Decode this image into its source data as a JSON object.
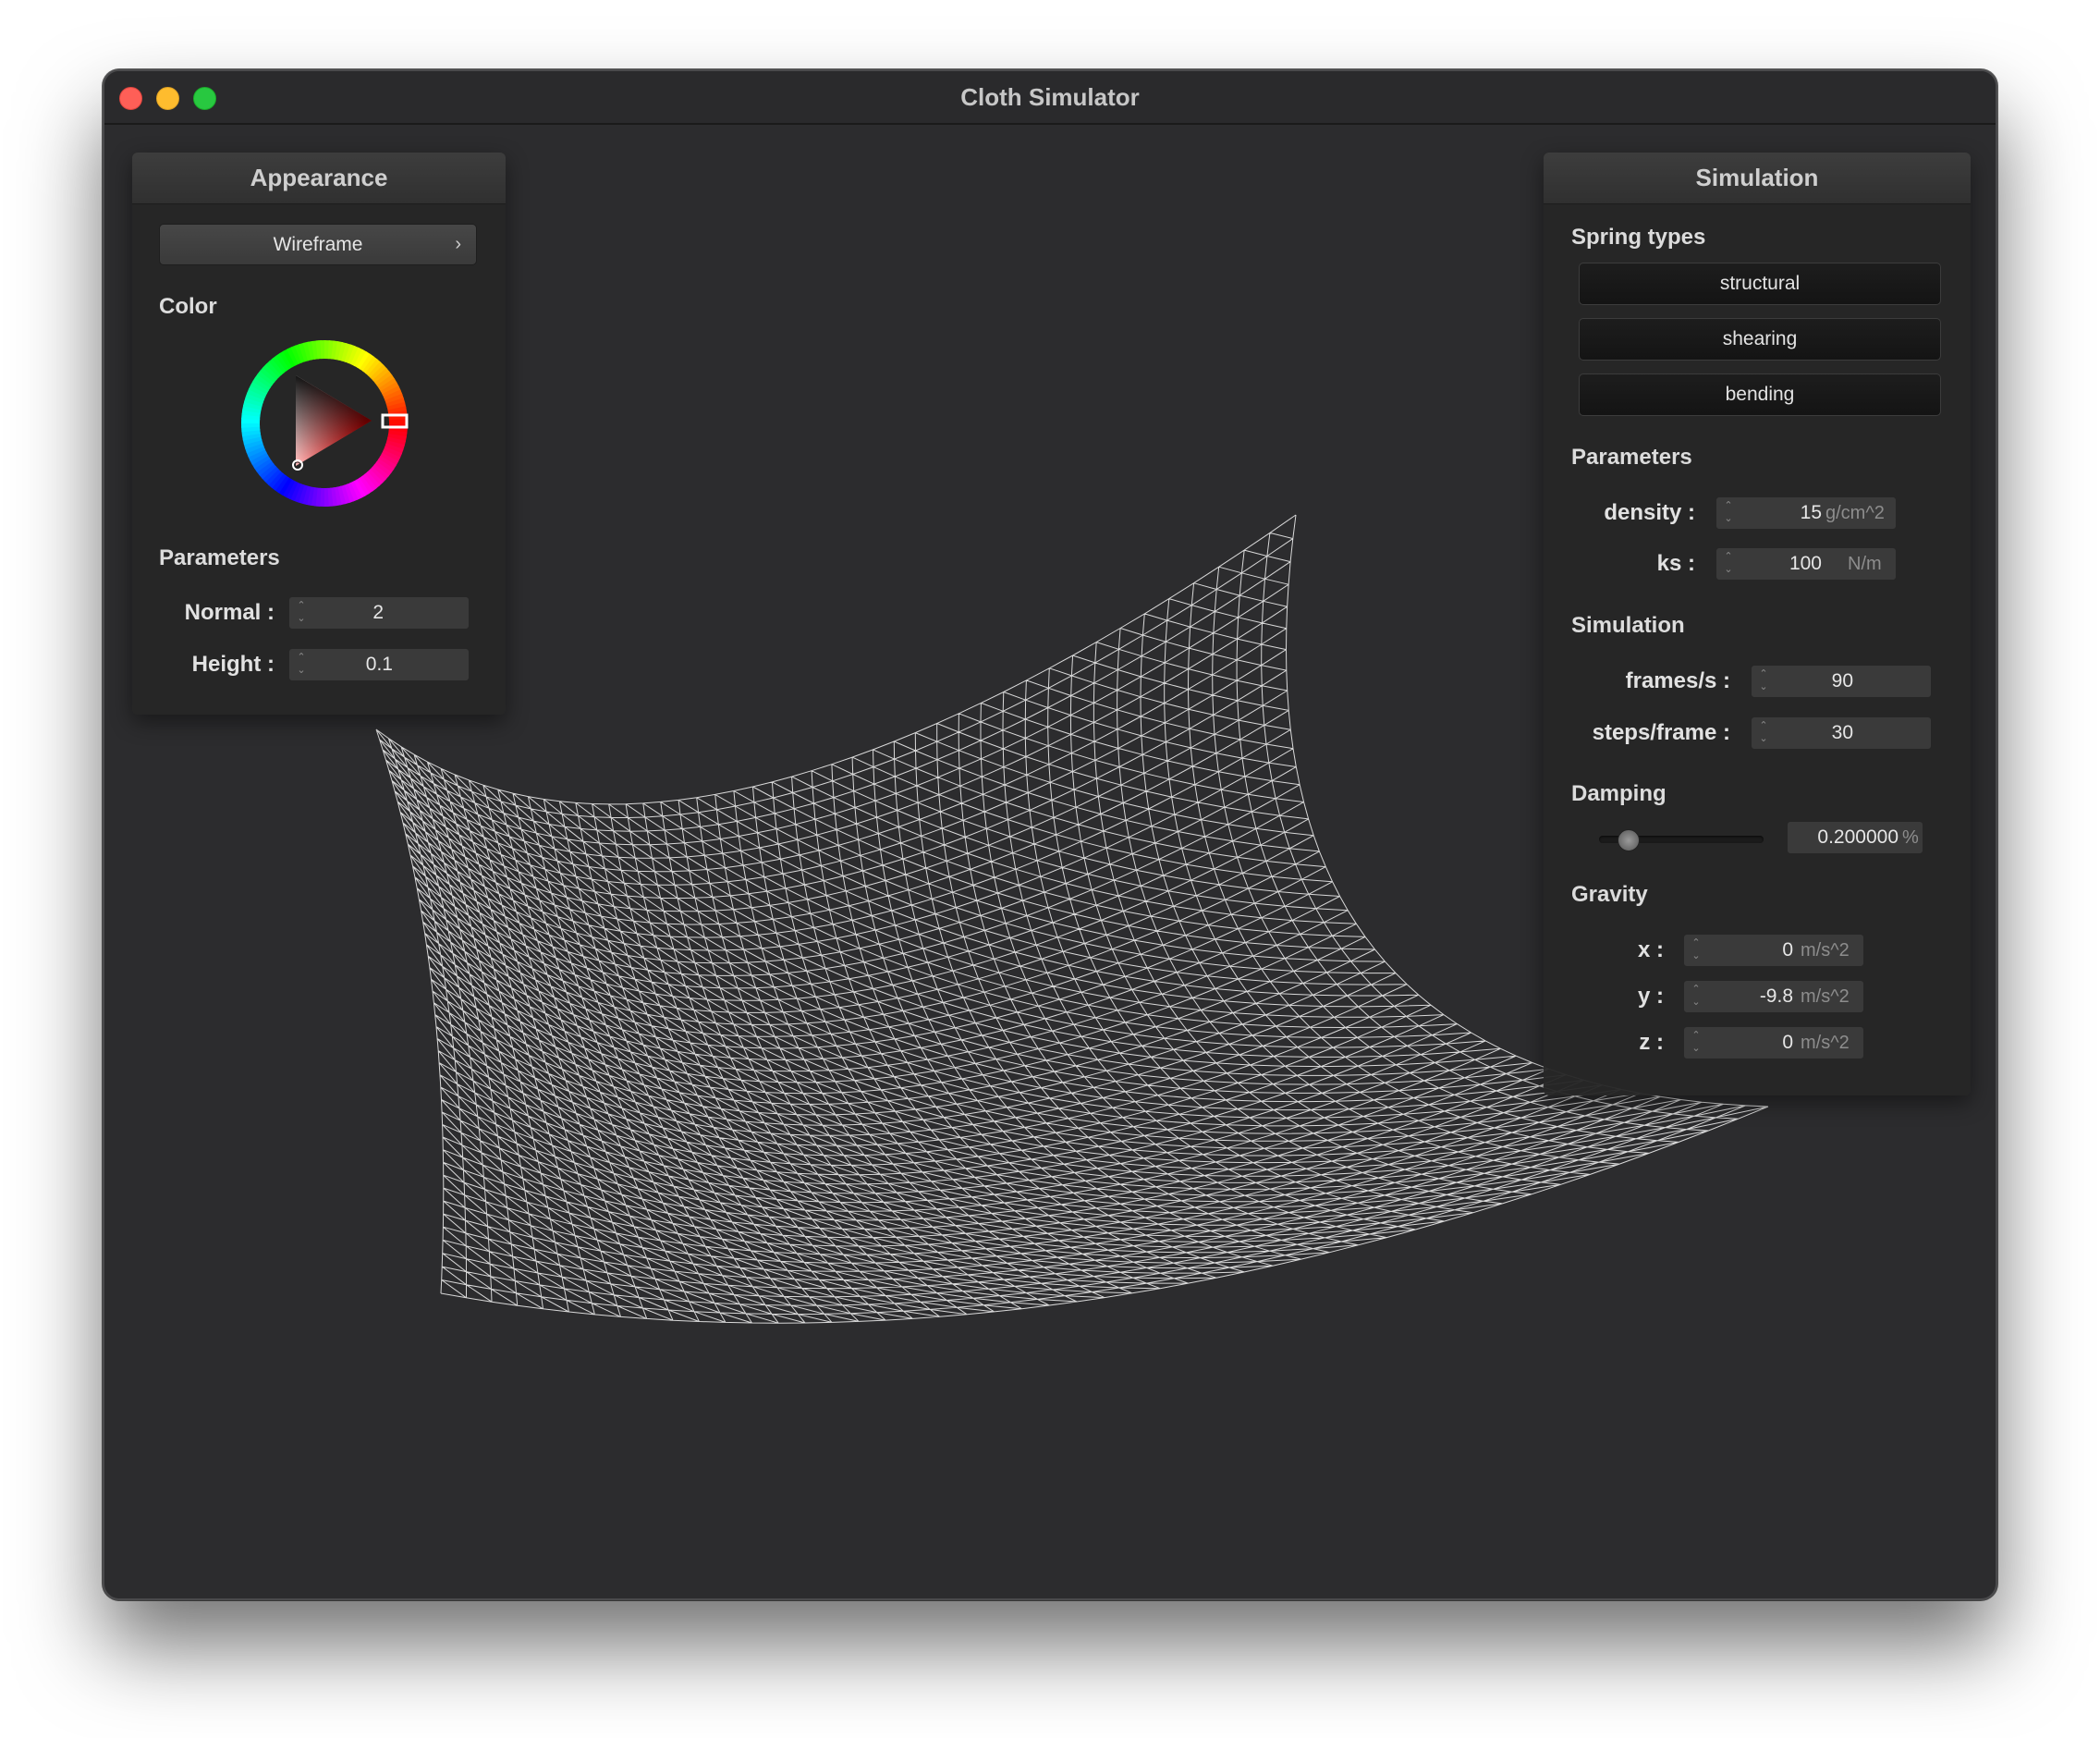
{
  "window": {
    "title": "Cloth Simulator"
  },
  "appearance": {
    "title": "Appearance",
    "shader": "Wireframe",
    "color_label": "Color",
    "color_value": "#ff0000",
    "parameters_label": "Parameters",
    "normal_label": "Normal :",
    "normal_value": "2",
    "height_label": "Height :",
    "height_value": "0.1"
  },
  "simulation": {
    "title": "Simulation",
    "spring_types_label": "Spring types",
    "spring_types": [
      "structural",
      "shearing",
      "bending"
    ],
    "parameters_label": "Parameters",
    "density_label": "density :",
    "density_value": "15",
    "density_unit": "g/cm^2",
    "ks_label": "ks :",
    "ks_value": "100",
    "ks_unit": "N/m",
    "simulation_label": "Simulation",
    "fps_label": "frames/s :",
    "fps_value": "90",
    "steps_label": "steps/frame :",
    "steps_value": "30",
    "damping_label": "Damping",
    "damping_value": "0.200000",
    "damping_unit": "%",
    "gravity_label": "Gravity",
    "gx_label": "x :",
    "gx_value": "0",
    "gy_label": "y :",
    "gy_value": "-9.8",
    "gz_label": "z :",
    "gz_value": "0",
    "gravity_unit": "m/s^2"
  },
  "theme": {
    "window_bg": "#2c2c2e",
    "mesh_color": "#ffffff",
    "accent_red": "#ff0000"
  }
}
